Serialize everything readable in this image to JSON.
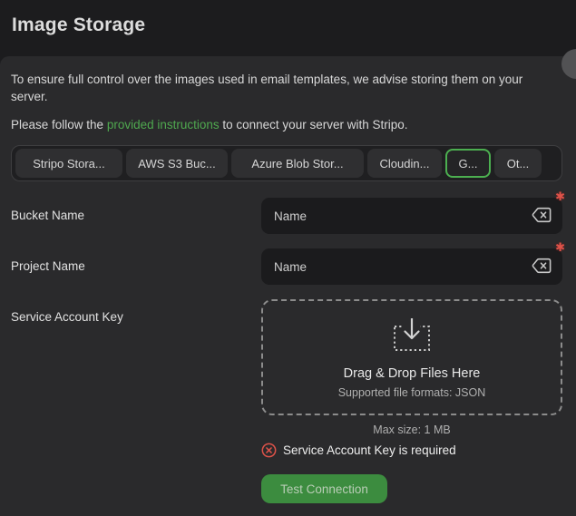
{
  "page_title": "Image Storage",
  "intro": {
    "line1": "To ensure full control over the images used in email templates, we advise storing them on your server.",
    "line2_prefix": "Please follow the ",
    "line2_link": "provided instructions",
    "line2_suffix": " to connect your server with Stripo."
  },
  "tabs": {
    "items": [
      {
        "label": "Stripo Stora...",
        "selected": false
      },
      {
        "label": "AWS S3 Buc...",
        "selected": false
      },
      {
        "label": "Azure Blob Stor...",
        "selected": false
      },
      {
        "label": "Cloudin...",
        "selected": false
      },
      {
        "label": "G...",
        "selected": true
      },
      {
        "label": "Ot...",
        "selected": false
      }
    ]
  },
  "form": {
    "bucket_name": {
      "label": "Bucket Name",
      "placeholder": "Name",
      "required": true
    },
    "project_name": {
      "label": "Project Name",
      "placeholder": "Name",
      "required": true
    },
    "service_account_key": {
      "label": "Service Account Key",
      "dropzone_title": "Drag & Drop Files Here",
      "dropzone_subtitle": "Supported file formats: JSON",
      "max_size_note": "Max size: 1 MB",
      "error_message": "Service Account Key is required"
    }
  },
  "actions": {
    "test_connection_label": "Test Connection"
  },
  "colors": {
    "page_background": "#1c1c1e",
    "panel_background": "#2a2a2c",
    "input_background": "#1b1b1d",
    "link_green": "#4fa94f",
    "selected_tab_border": "#4caf50",
    "button_green": "#3c8c3f",
    "error_red": "#dd5249"
  }
}
